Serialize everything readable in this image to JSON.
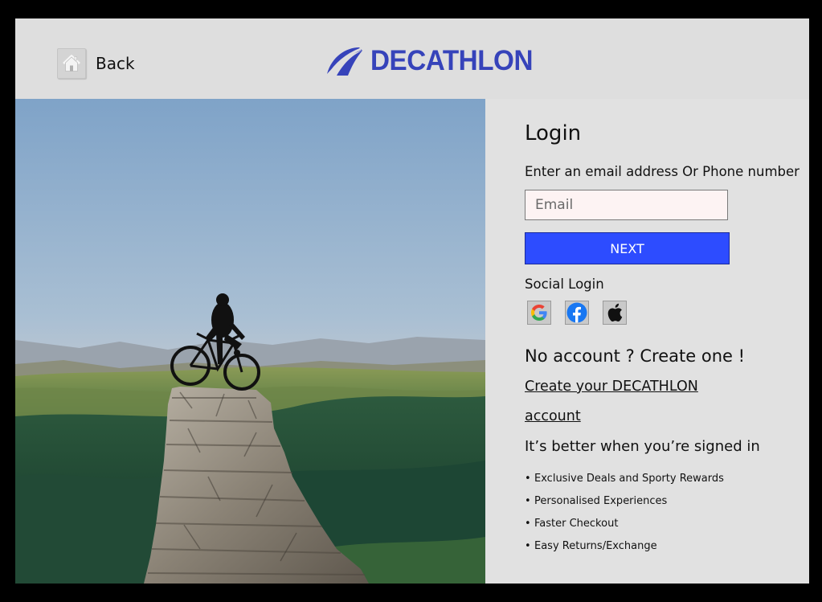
{
  "header": {
    "back_label": "Back",
    "brand": "DECATHLON",
    "brand_color": "#3643ba"
  },
  "hero": {
    "icon": "mountain-cyclist-photo"
  },
  "login": {
    "title": "Login",
    "prompt": "Enter an email address Or Phone number",
    "email_placeholder": "Email",
    "email_value": "",
    "next_label": "NEXT",
    "next_color": "#2d4cff",
    "social_label": "Social Login",
    "social_buttons": [
      "google-icon",
      "facebook-icon",
      "apple-icon"
    ],
    "no_account": "No account ? Create one !",
    "create_link": "Create your DECATHLON account",
    "better_heading": "It’s better when you’re signed in",
    "benefits": [
      "Exclusive Deals and Sporty Rewards",
      "Personalised Experiences",
      "Faster Checkout",
      "Easy Returns/Exchange"
    ]
  }
}
